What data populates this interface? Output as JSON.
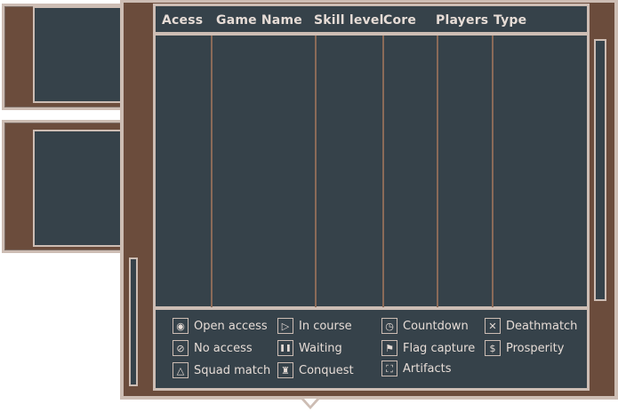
{
  "table": {
    "columns": [
      "Acess",
      "Game Name",
      "Skill level",
      "Core",
      "Players",
      "Type"
    ],
    "rows": []
  },
  "legend": [
    {
      "label": "Open access",
      "icon": "circle-dot-icon",
      "glyph": "◉"
    },
    {
      "label": "In course",
      "icon": "play-icon",
      "glyph": "▷"
    },
    {
      "label": "Countdown",
      "icon": "countdown-icon",
      "glyph": "◷"
    },
    {
      "label": "Deathmatch",
      "icon": "deathmatch-icon",
      "glyph": "✕"
    },
    {
      "label": "No access",
      "icon": "no-access-icon",
      "glyph": "⊘"
    },
    {
      "label": "Waiting",
      "icon": "pause-icon",
      "glyph": "❚❚"
    },
    {
      "label": "Flag capture",
      "icon": "flag-icon",
      "glyph": "⚑"
    },
    {
      "label": "Prosperity",
      "icon": "dollar-icon",
      "glyph": "$"
    },
    {
      "label": "Squad match",
      "icon": "squad-icon",
      "glyph": "△"
    },
    {
      "label": "Conquest",
      "icon": "conquest-icon",
      "glyph": "♜"
    },
    {
      "label": "Artifacts",
      "icon": "artifacts-icon",
      "glyph": "⛶"
    }
  ],
  "colors": {
    "panel": "#36424a",
    "frame": "#6b4c3c",
    "rim": "#cdbdb4",
    "text": "#e6dcd6"
  }
}
